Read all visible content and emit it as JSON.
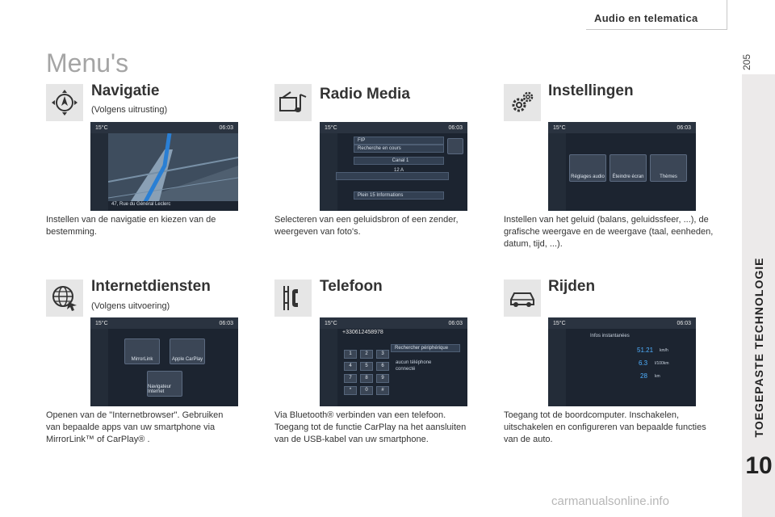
{
  "header": {
    "chapter_title": "Audio en telematica",
    "page_number": "205"
  },
  "side": {
    "section_label": "TOEGEPASTE TECHNOLOGIE",
    "chapter_number": "10"
  },
  "page_title": "Menu's",
  "sections": {
    "navigatie": {
      "title": "Navigatie",
      "subtitle": "(Volgens uitrusting)",
      "description": "Instellen van de navigatie en kiezen van de bestemming.",
      "icon": "navigation-compass-icon",
      "screen": {
        "temp": "15°C",
        "time": "06:03",
        "address": "47, Rue du Général Leclerc"
      }
    },
    "radio_media": {
      "title": "Radio Media",
      "description": "Selecteren van een geluidsbron of een zender, weergeven van foto's.",
      "icon": "radio-media-icon",
      "screen": {
        "temp": "15°C",
        "time": "06:03",
        "station": "FIP",
        "search": "Recherche en cours",
        "channel": "Canal 1",
        "freq": "12 A",
        "info": "Plein 15 Informations"
      }
    },
    "instellingen": {
      "title": "Instellingen",
      "description": "Instellen van het geluid (balans, geluidssfeer, ...), de grafische weergave en de weergave (taal, eenheden, datum, tijd, ...).",
      "icon": "settings-gears-icon",
      "screen": {
        "temp": "15°C",
        "time": "06:03",
        "tiles": [
          "Réglages audio",
          "Éteindre écran",
          "Thèmes"
        ]
      }
    },
    "internetdiensten": {
      "title": "Internetdiensten",
      "subtitle": "(Volgens uitvoering)",
      "description": "Openen van de \"Internetbrowser\". Gebruiken van bepaalde apps van uw smartphone via MirrorLink™ of CarPlay® .",
      "icon": "internet-globe-icon",
      "screen": {
        "temp": "15°C",
        "time": "06:03",
        "tiles": [
          "MirrorLink",
          "Apple CarPlay",
          "Navigateur Internet"
        ]
      }
    },
    "telefoon": {
      "title": "Telefoon",
      "description": "Via Bluetooth® verbinden van een telefoon. Toegang tot de functie CarPlay na het aansluiten van de USB-kabel van uw smartphone.",
      "icon": "phone-icon",
      "screen": {
        "temp": "15°C",
        "time": "06:03",
        "number": "+330612458978",
        "action": "Rechercher périphérique",
        "status": "aucun téléphone connecté",
        "keys": [
          "1",
          "2",
          "3",
          "4",
          "5",
          "6",
          "7",
          "8",
          "9",
          "*",
          "0",
          "#"
        ]
      }
    },
    "rijden": {
      "title": "Rijden",
      "description": "Toegang tot de boordcomputer. Inschakelen, uitschakelen en configureren van bepaalde functies van de auto.",
      "icon": "car-driving-icon",
      "screen": {
        "temp": "15°C",
        "time": "06:03",
        "heading": "Infos instantanées",
        "values": [
          "51.21",
          "6.3",
          "28"
        ],
        "units": [
          "km/h",
          "l/100km",
          "km"
        ]
      }
    }
  },
  "watermark": "carmanualsonline.info",
  "colors": {
    "accent_blue": "#2a7fd4",
    "screen_bg": "#1c2430",
    "icon_bg": "#e6e6e6"
  }
}
